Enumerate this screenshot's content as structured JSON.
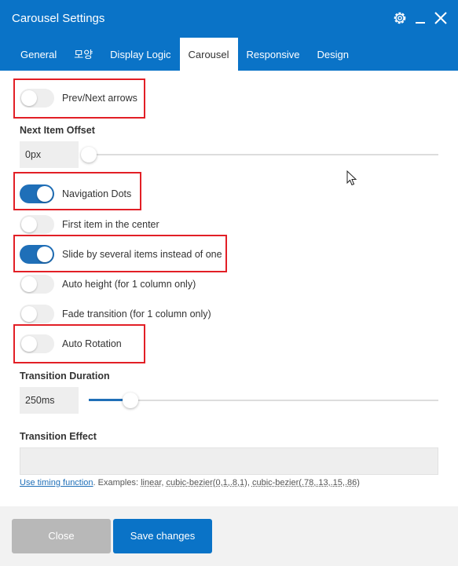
{
  "window": {
    "title": "Carousel Settings"
  },
  "tabs": [
    {
      "label": "General"
    },
    {
      "label": "모양"
    },
    {
      "label": "Display Logic"
    },
    {
      "label": "Carousel"
    },
    {
      "label": "Responsive"
    },
    {
      "label": "Design"
    }
  ],
  "active_tab": "Carousel",
  "settings": {
    "prev_next": {
      "label": "Prev/Next arrows",
      "enabled": false
    },
    "next_item_offset": {
      "label": "Next Item Offset",
      "value": "0px",
      "slider_fraction": 0
    },
    "nav_dots": {
      "label": "Navigation Dots",
      "enabled": true
    },
    "first_center": {
      "label": "First item in the center",
      "enabled": false
    },
    "slide_several": {
      "label": "Slide by several items instead of one",
      "enabled": true
    },
    "auto_height": {
      "label": "Auto height (for 1 column only)",
      "enabled": false
    },
    "fade": {
      "label": "Fade transition (for 1 column only)",
      "enabled": false
    },
    "auto_rotation": {
      "label": "Auto Rotation",
      "enabled": false
    },
    "transition_duration": {
      "label": "Transition Duration",
      "value": "250ms",
      "slider_fraction": 0.12
    },
    "transition_effect": {
      "label": "Transition Effect",
      "value": "",
      "help_link": "Use timing function",
      "help_examples_prefix": ". Examples: ",
      "examples": [
        "linear",
        "cubic-bezier(0,1,.8,1)",
        "cubic-bezier(.78,.13,.15,.86)"
      ]
    }
  },
  "footer": {
    "close_label": "Close",
    "save_label": "Save changes"
  },
  "colors": {
    "header": "#0a73c7",
    "highlight": "#e21f26",
    "toggle_on": "#1f6fb8"
  },
  "icons": [
    "gear-icon",
    "minimize-icon",
    "close-icon"
  ]
}
